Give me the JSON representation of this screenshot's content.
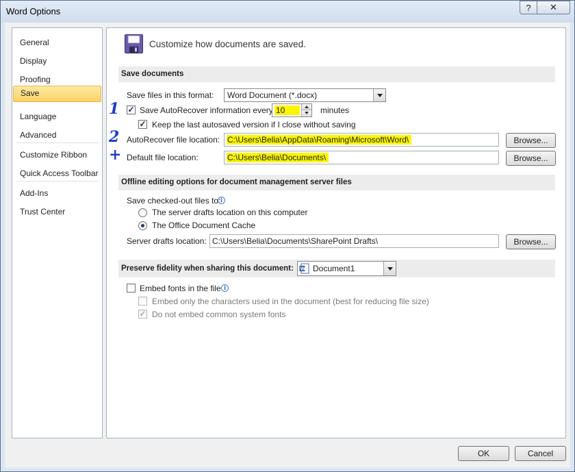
{
  "window": {
    "title": "Word Options",
    "help_label": "?",
    "close_label": "✕"
  },
  "nav": {
    "items": [
      {
        "label": "General"
      },
      {
        "label": "Display"
      },
      {
        "label": "Proofing"
      },
      {
        "label": "Save",
        "selected": true
      },
      {
        "label": "Language"
      },
      {
        "label": "Advanced"
      },
      {
        "label": "Customize Ribbon"
      },
      {
        "label": "Quick Access Toolbar"
      },
      {
        "label": "Add-Ins"
      },
      {
        "label": "Trust Center"
      }
    ]
  },
  "header": {
    "title": "Customize how documents are saved.",
    "icon": "floppy-disk-icon"
  },
  "save_documents": {
    "heading": "Save documents",
    "format_label": "Save files in this format:",
    "format_value": "Word Document (*.docx)",
    "autorecover_label": "Save AutoRecover information every",
    "autorecover_checked": true,
    "autorecover_minutes": "10",
    "minutes_label": "minutes",
    "keep_label": "Keep the last autosaved version if I close without saving",
    "keep_checked": true,
    "autorecover_location_label": "AutoRecover file location:",
    "autorecover_location_value": "C:\\Users\\Belia\\AppData\\Roaming\\Microsoft\\Word\\",
    "default_location_label": "Default file location:",
    "default_location_value": "C:\\Users\\Belia\\Documents\\",
    "browse_label": "Browse..."
  },
  "offline": {
    "heading": "Offline editing options for document management server files",
    "save_to_label": "Save checked-out files to:",
    "option_server": "The server drafts location on this computer",
    "option_cache": "The Office Document Cache",
    "selected": "cache",
    "drafts_label": "Server drafts location:",
    "drafts_value": "C:\\Users\\Belia\\Documents\\SharePoint Drafts\\",
    "browse_label": "Browse..."
  },
  "fidelity": {
    "heading": "Preserve fidelity when sharing this document:",
    "document_value": "Document1",
    "embed_fonts_label": "Embed fonts in the file",
    "embed_fonts_checked": false,
    "embed_only_label": "Embed only the characters used in the document (best for reducing file size)",
    "do_not_embed_label": "Do not embed common system fonts",
    "do_not_embed_checked": true
  },
  "annotations": {
    "mark1": "1",
    "mark2": "2",
    "mark3": "+"
  },
  "footer": {
    "ok_label": "OK",
    "cancel_label": "Cancel"
  }
}
